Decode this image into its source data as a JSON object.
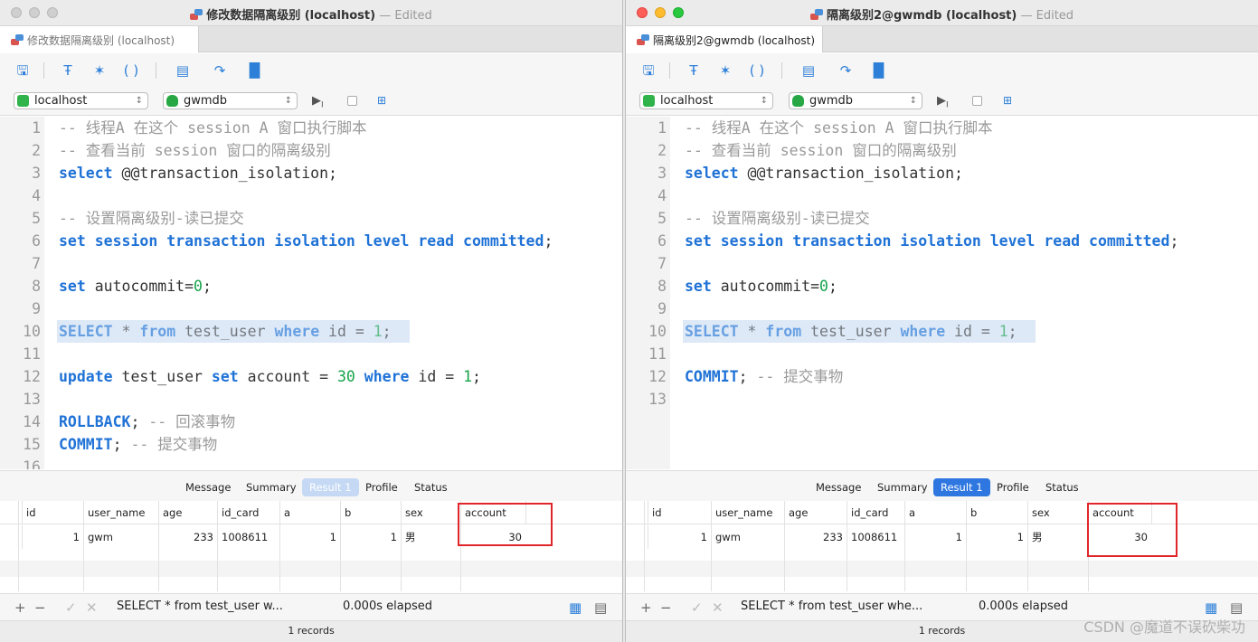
{
  "left": {
    "window_title": "修改数据隔离级别 (localhost)",
    "edited": "— Edited",
    "tab_label": "修改数据隔离级别 (localhost)",
    "connection": "localhost",
    "database": "gwmdb",
    "code_lines": [
      {
        "n": "1",
        "parts": [
          {
            "t": "-- 线程A 在这个 session A 窗口执行脚本",
            "c": "cm"
          }
        ]
      },
      {
        "n": "2",
        "parts": [
          {
            "t": "-- 查看当前 session 窗口的隔离级别",
            "c": "cm"
          }
        ]
      },
      {
        "n": "3",
        "parts": [
          {
            "t": "select",
            "c": "kw"
          },
          {
            "t": " @@transaction_isolation;",
            "c": ""
          }
        ]
      },
      {
        "n": "4",
        "parts": []
      },
      {
        "n": "5",
        "parts": [
          {
            "t": "-- 设置隔离级别-读已提交",
            "c": "cm"
          }
        ]
      },
      {
        "n": "6",
        "parts": [
          {
            "t": "set session transaction isolation level read committed",
            "c": "kw"
          },
          {
            "t": ";",
            "c": ""
          }
        ]
      },
      {
        "n": "7",
        "parts": []
      },
      {
        "n": "8",
        "parts": [
          {
            "t": "set",
            "c": "kw"
          },
          {
            "t": " autocommit=",
            "c": ""
          },
          {
            "t": "0",
            "c": "nm"
          },
          {
            "t": ";",
            "c": ""
          }
        ]
      },
      {
        "n": "9",
        "parts": []
      },
      {
        "n": "10",
        "hl": true,
        "parts": [
          {
            "t": "SELECT",
            "c": "kw"
          },
          {
            "t": " * ",
            "c": ""
          },
          {
            "t": "from",
            "c": "kw"
          },
          {
            "t": " test_user ",
            "c": ""
          },
          {
            "t": "where",
            "c": "kw"
          },
          {
            "t": " id = ",
            "c": ""
          },
          {
            "t": "1",
            "c": "nm"
          },
          {
            "t": ";",
            "c": ""
          }
        ]
      },
      {
        "n": "11",
        "parts": []
      },
      {
        "n": "12",
        "parts": [
          {
            "t": "update",
            "c": "kw"
          },
          {
            "t": " test_user ",
            "c": ""
          },
          {
            "t": "set",
            "c": "kw"
          },
          {
            "t": " account = ",
            "c": ""
          },
          {
            "t": "30",
            "c": "nm"
          },
          {
            "t": " ",
            "c": ""
          },
          {
            "t": "where",
            "c": "kw"
          },
          {
            "t": " id = ",
            "c": ""
          },
          {
            "t": "1",
            "c": "nm"
          },
          {
            "t": ";",
            "c": ""
          }
        ]
      },
      {
        "n": "13",
        "parts": []
      },
      {
        "n": "14",
        "parts": [
          {
            "t": "ROLLBACK",
            "c": "kw"
          },
          {
            "t": "; ",
            "c": ""
          },
          {
            "t": "-- 回滚事物",
            "c": "cm"
          }
        ]
      },
      {
        "n": "15",
        "parts": [
          {
            "t": "COMMIT",
            "c": "kw"
          },
          {
            "t": "; ",
            "c": ""
          },
          {
            "t": "-- 提交事物",
            "c": "cm"
          }
        ]
      },
      {
        "n": "16",
        "parts": []
      }
    ],
    "result_tabs": [
      "Message",
      "Summary",
      "Result 1",
      "Profile",
      "Status"
    ],
    "active_result_tab": "Result 1",
    "columns": [
      "id",
      "user_name",
      "age",
      "id_card",
      "a",
      "b",
      "sex",
      "account"
    ],
    "row": [
      "1",
      "gwm",
      "233",
      "1008611",
      "1",
      "1",
      "男",
      "30"
    ],
    "status_query": "SELECT * from test_user w...",
    "elapsed": "0.000s elapsed",
    "records": "1 records"
  },
  "right": {
    "window_title": "隔离级别2@gwmdb (localhost)",
    "edited": "— Edited",
    "tab_label": "隔离级别2@gwmdb (localhost)",
    "connection": "localhost",
    "database": "gwmdb",
    "code_lines": [
      {
        "n": "1",
        "parts": [
          {
            "t": "-- 线程A 在这个 session A 窗口执行脚本",
            "c": "cm"
          }
        ]
      },
      {
        "n": "2",
        "parts": [
          {
            "t": "-- 查看当前 session 窗口的隔离级别",
            "c": "cm"
          }
        ]
      },
      {
        "n": "3",
        "parts": [
          {
            "t": "select",
            "c": "kw"
          },
          {
            "t": " @@transaction_isolation;",
            "c": ""
          }
        ]
      },
      {
        "n": "4",
        "parts": []
      },
      {
        "n": "5",
        "parts": [
          {
            "t": "-- 设置隔离级别-读已提交",
            "c": "cm"
          }
        ]
      },
      {
        "n": "6",
        "parts": [
          {
            "t": "set session transaction isolation level read committed",
            "c": "kw"
          },
          {
            "t": ";",
            "c": ""
          }
        ]
      },
      {
        "n": "7",
        "parts": []
      },
      {
        "n": "8",
        "parts": [
          {
            "t": "set",
            "c": "kw"
          },
          {
            "t": " autocommit=",
            "c": ""
          },
          {
            "t": "0",
            "c": "nm"
          },
          {
            "t": ";",
            "c": ""
          }
        ]
      },
      {
        "n": "9",
        "parts": []
      },
      {
        "n": "10",
        "hl": true,
        "parts": [
          {
            "t": "SELECT",
            "c": "kw"
          },
          {
            "t": " * ",
            "c": ""
          },
          {
            "t": "from",
            "c": "kw"
          },
          {
            "t": " test_user ",
            "c": ""
          },
          {
            "t": "where",
            "c": "kw"
          },
          {
            "t": " id = ",
            "c": ""
          },
          {
            "t": "1",
            "c": "nm"
          },
          {
            "t": ";",
            "c": ""
          }
        ]
      },
      {
        "n": "11",
        "parts": []
      },
      {
        "n": "12",
        "parts": [
          {
            "t": "COMMIT",
            "c": "kw"
          },
          {
            "t": "; ",
            "c": ""
          },
          {
            "t": "-- 提交事物",
            "c": "cm"
          }
        ]
      },
      {
        "n": "13",
        "parts": []
      }
    ],
    "result_tabs": [
      "Message",
      "Summary",
      "Result 1",
      "Profile",
      "Status"
    ],
    "active_result_tab": "Result 1",
    "columns": [
      "id",
      "user_name",
      "age",
      "id_card",
      "a",
      "b",
      "sex",
      "account"
    ],
    "row": [
      "1",
      "gwm",
      "233",
      "1008611",
      "1",
      "1",
      "男",
      "30"
    ],
    "status_query": "SELECT * from test_user whe...",
    "elapsed": "0.000s elapsed",
    "records": "1 records"
  },
  "watermark": "CSDN @魔道不误砍柴功",
  "colors": {
    "keyword": "#1f72d6",
    "comment": "#9a9a9a",
    "number": "#16a34a",
    "highlight_box": "#e0262b",
    "active_tab": "#2f77e0"
  },
  "icons": [
    "save-icon",
    "format-icon",
    "magic-wand-icon",
    "parentheses-icon",
    "document-icon",
    "export-icon",
    "chart-icon",
    "run-icon",
    "explain-icon",
    "add-icon",
    "remove-icon",
    "apply-icon",
    "discard-icon",
    "grid-view-icon",
    "form-view-icon"
  ]
}
